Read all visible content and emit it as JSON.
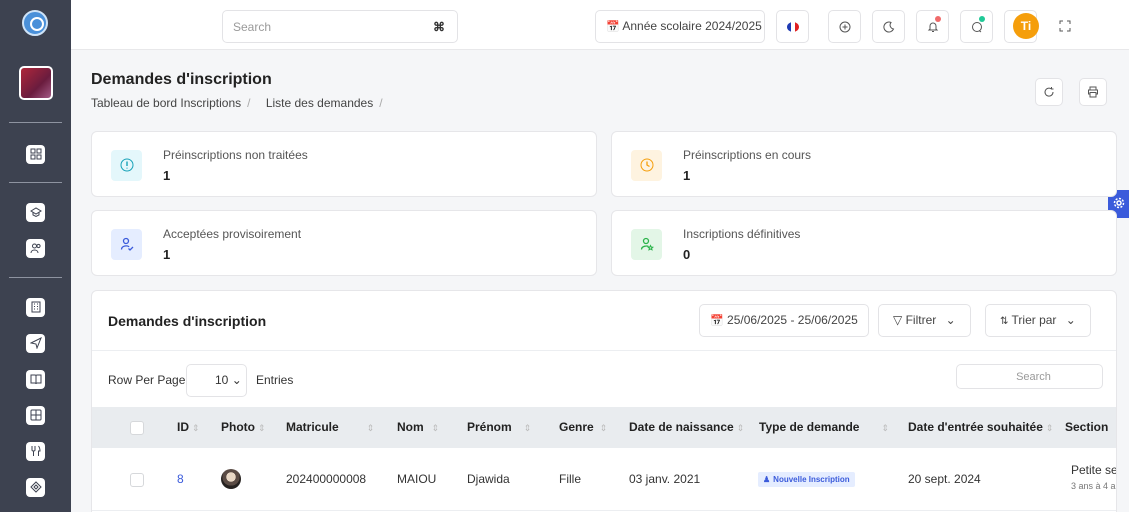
{
  "topbar": {
    "search_placeholder": "Search",
    "search_shortcut": "⌘",
    "school_year": "Année scolaire 2024/2025",
    "user_initials": "Ti",
    "accent_color": "#f59e0b"
  },
  "header": {
    "title": "Demandes d'inscription",
    "breadcrumb": [
      "Tableau de bord",
      "Inscriptions",
      "Liste des demandes"
    ]
  },
  "stats": [
    {
      "label": "Préinscriptions non traitées",
      "value": "1",
      "color": "#17a2b8"
    },
    {
      "label": "Préinscriptions en cours",
      "value": "1",
      "color": "#f59e0b"
    },
    {
      "label": "Acceptées provisoirement",
      "value": "1",
      "color": "#3b5bdb"
    },
    {
      "label": "Inscriptions définitives",
      "value": "0",
      "color": "#2bb34a"
    }
  ],
  "panel": {
    "title": "Demandes d'inscription",
    "date_range": "25/06/2025 - 25/06/2025",
    "filter_label": "Filtrer",
    "sort_label": "Trier par",
    "rows_per_page_label": "Row Per Page",
    "rows_per_page_value": "10",
    "entries_label": "Entries",
    "search_placeholder": "Search"
  },
  "table": {
    "columns": [
      "ID",
      "Photo",
      "Matricule",
      "Nom",
      "Prénom",
      "Genre",
      "Date de naissance",
      "Type de demande",
      "Date d'entrée souhaitée",
      "Section"
    ],
    "rows": [
      {
        "id": "8",
        "matricule": "202400000008",
        "nom": "MAIOU",
        "prenom": "Djawida",
        "genre": "Fille",
        "date_naissance": "03 janv. 2021",
        "type_demande": "Nouvelle Inscription",
        "date_entree": "20 sept. 2024",
        "section": "Petite se",
        "section_sub": "3 ans à 4 a"
      }
    ]
  }
}
